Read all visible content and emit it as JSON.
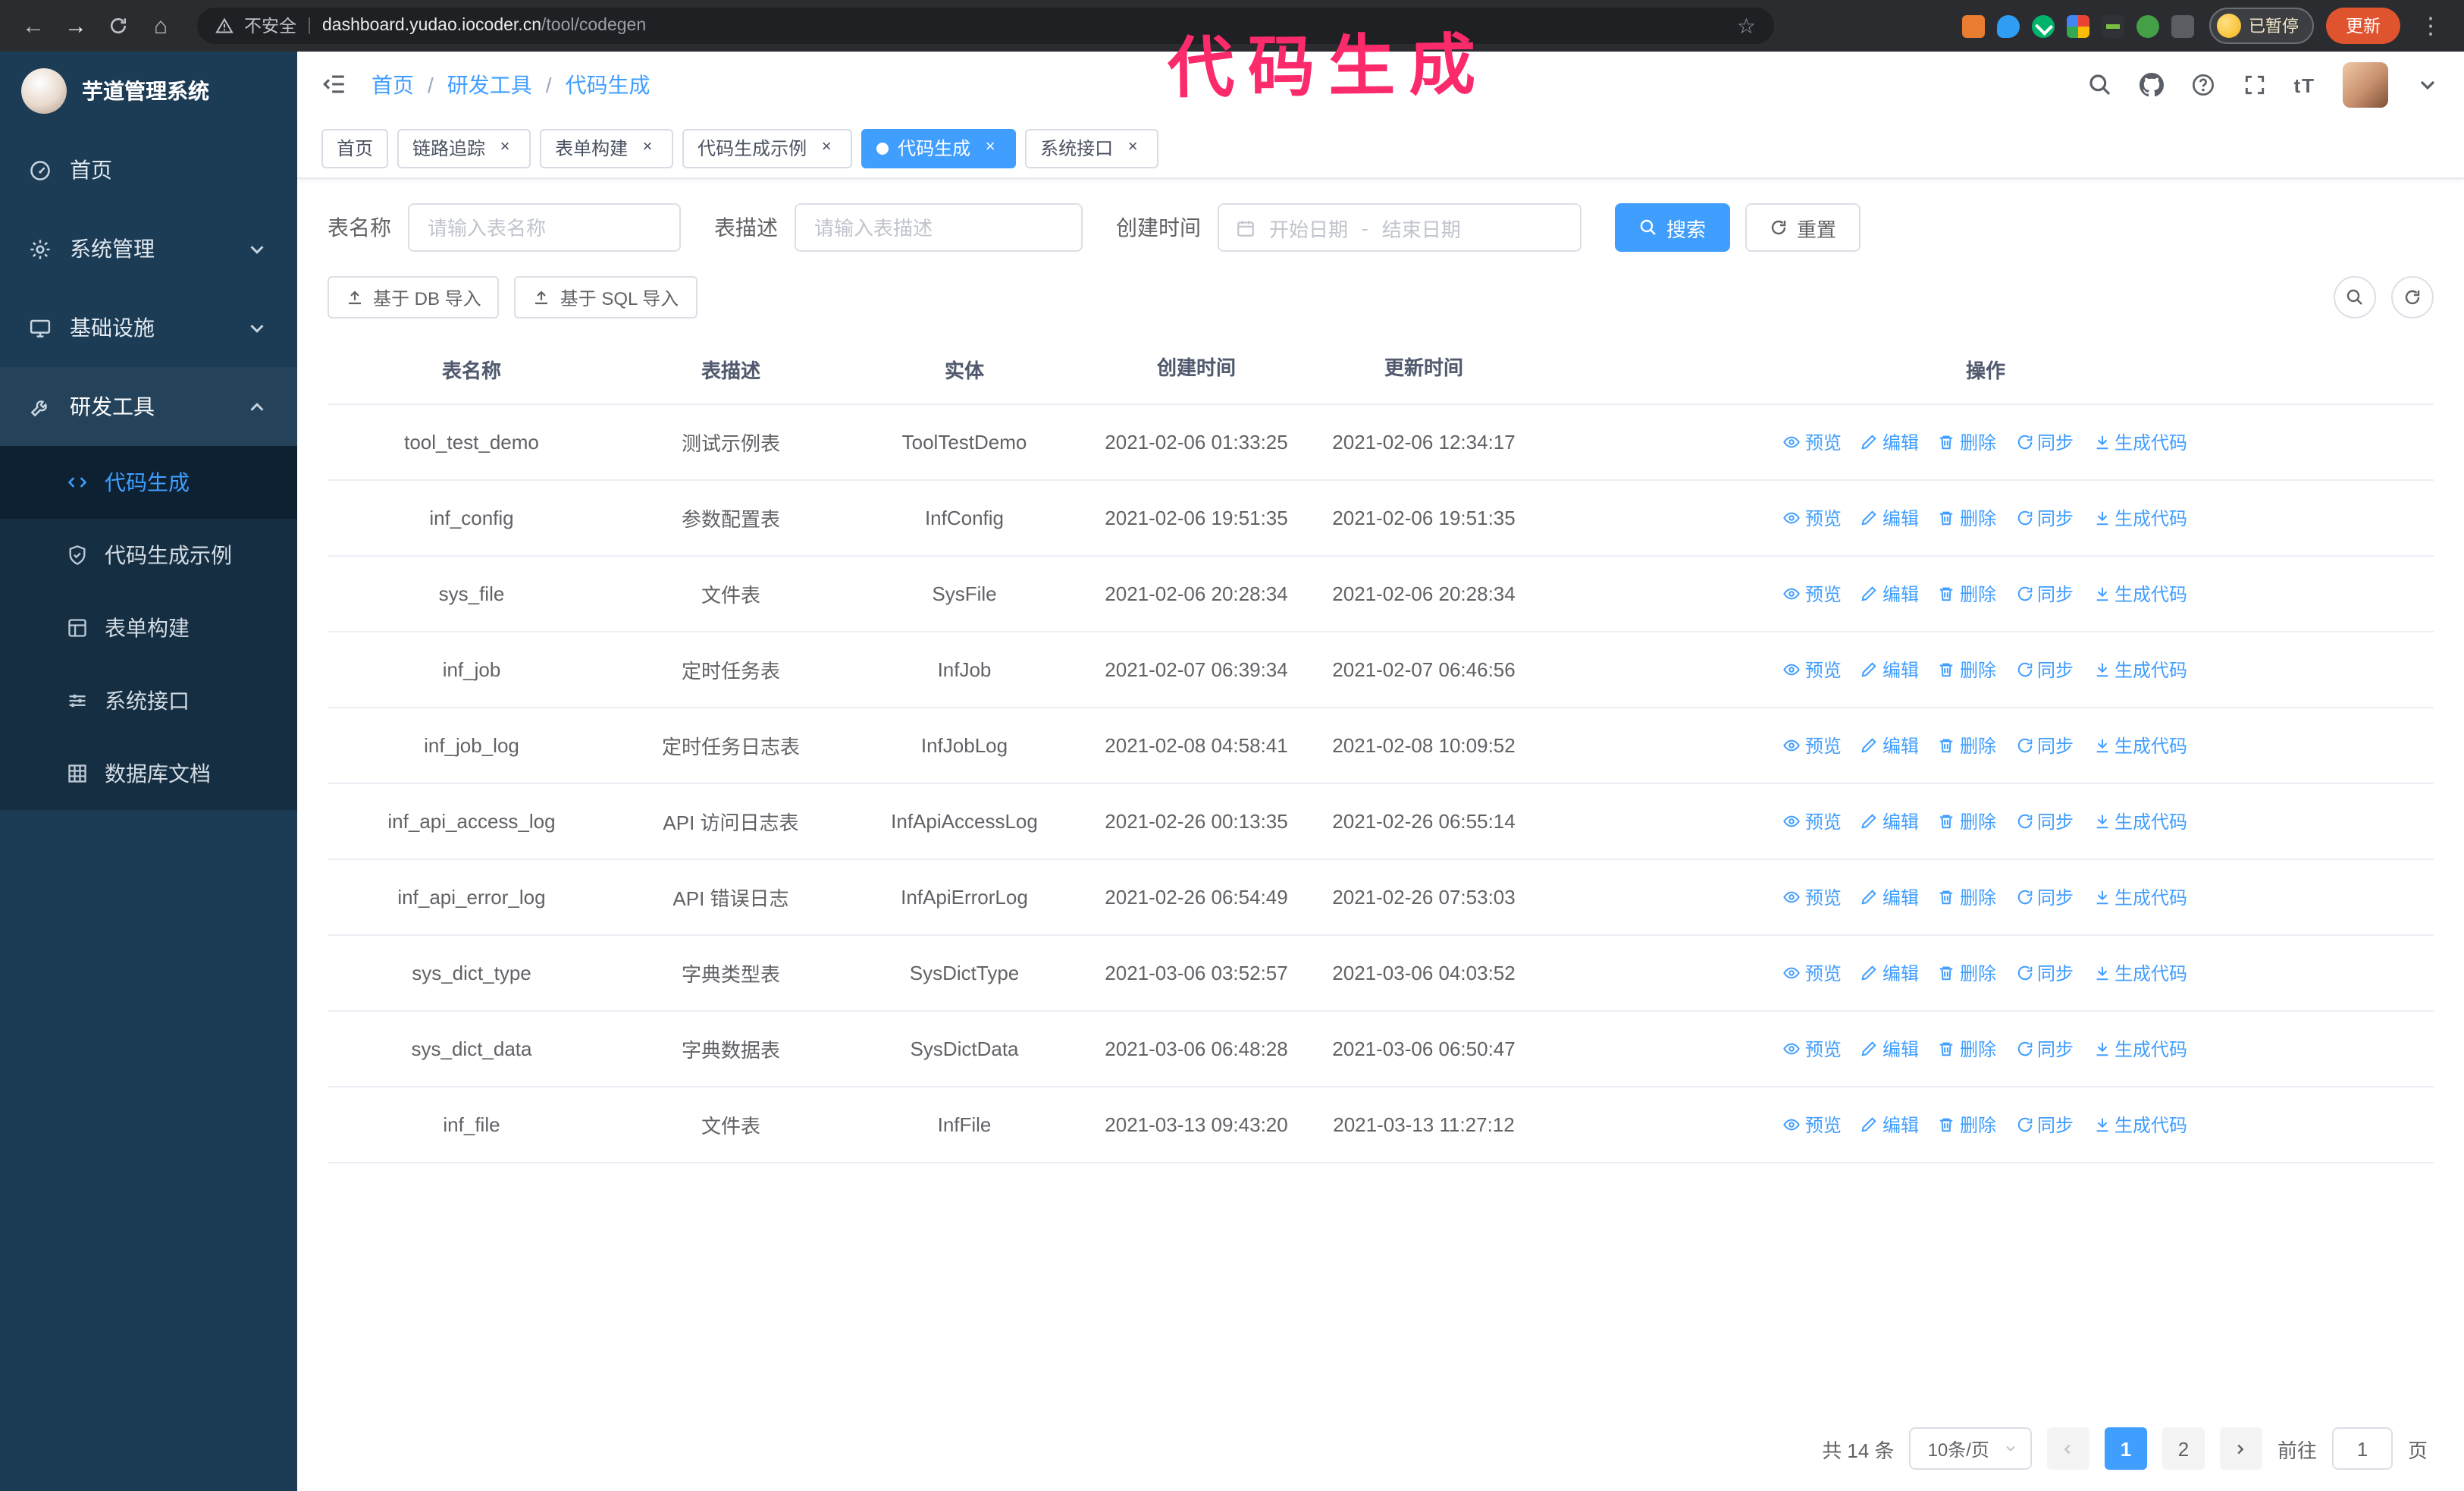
{
  "browser": {
    "security_warning": "不安全",
    "separator": "|",
    "url_host": "dashboard.yudao.iocoder.cn",
    "url_path": "/tool/codegen",
    "paused_badge": "已暂停",
    "update_button": "更新"
  },
  "annotation": {
    "text": "代码生成",
    "color": "#fb2a6b"
  },
  "sidebar": {
    "title": "芋道管理系统",
    "items": [
      {
        "label": "首页"
      },
      {
        "label": "系统管理"
      },
      {
        "label": "基础设施"
      },
      {
        "label": "研发工具"
      }
    ],
    "subitems": [
      {
        "label": "代码生成"
      },
      {
        "label": "代码生成示例"
      },
      {
        "label": "表单构建"
      },
      {
        "label": "系统接口"
      },
      {
        "label": "数据库文档"
      }
    ]
  },
  "breadcrumb": {
    "separator": "/",
    "items": [
      "首页",
      "研发工具",
      "代码生成"
    ]
  },
  "tabs": [
    {
      "label": "首页"
    },
    {
      "label": "链路追踪"
    },
    {
      "label": "表单构建"
    },
    {
      "label": "代码生成示例"
    },
    {
      "label": "代码生成"
    },
    {
      "label": "系统接口"
    }
  ],
  "filters": {
    "name_label": "表名称",
    "name_placeholder": "请输入表名称",
    "desc_label": "表描述",
    "desc_placeholder": "请输入表描述",
    "time_label": "创建时间",
    "start_placeholder": "开始日期",
    "range_separator": "-",
    "end_placeholder": "结束日期",
    "search_button": "搜索",
    "reset_button": "重置"
  },
  "toolbar": {
    "import_db_button": "基于 DB 导入",
    "import_sql_button": "基于 SQL 导入"
  },
  "table": {
    "columns": [
      "表名称",
      "表描述",
      "实体",
      "创建时间",
      "更新时间",
      "操作"
    ],
    "actions": [
      "预览",
      "编辑",
      "删除",
      "同步",
      "生成代码"
    ],
    "rows": [
      {
        "name": "tool_test_demo",
        "desc": "测试示例表",
        "entity": "ToolTestDemo",
        "created": "2021-02-06 01:33:25",
        "updated": "2021-02-06 12:34:17"
      },
      {
        "name": "inf_config",
        "desc": "参数配置表",
        "entity": "InfConfig",
        "created": "2021-02-06 19:51:35",
        "updated": "2021-02-06 19:51:35"
      },
      {
        "name": "sys_file",
        "desc": "文件表",
        "entity": "SysFile",
        "created": "2021-02-06 20:28:34",
        "updated": "2021-02-06 20:28:34"
      },
      {
        "name": "inf_job",
        "desc": "定时任务表",
        "entity": "InfJob",
        "created": "2021-02-07 06:39:34",
        "updated": "2021-02-07 06:46:56"
      },
      {
        "name": "inf_job_log",
        "desc": "定时任务日志表",
        "entity": "InfJobLog",
        "created": "2021-02-08 04:58:41",
        "updated": "2021-02-08 10:09:52"
      },
      {
        "name": "inf_api_access_log",
        "desc": "API 访问日志表",
        "entity": "InfApiAccessLog",
        "created": "2021-02-26 00:13:35",
        "updated": "2021-02-26 06:55:14"
      },
      {
        "name": "inf_api_error_log",
        "desc": "API 错误日志",
        "entity": "InfApiErrorLog",
        "created": "2021-02-26 06:54:49",
        "updated": "2021-02-26 07:53:03"
      },
      {
        "name": "sys_dict_type",
        "desc": "字典类型表",
        "entity": "SysDictType",
        "created": "2021-03-06 03:52:57",
        "updated": "2021-03-06 04:03:52"
      },
      {
        "name": "sys_dict_data",
        "desc": "字典数据表",
        "entity": "SysDictData",
        "created": "2021-03-06 06:48:28",
        "updated": "2021-03-06 06:50:47"
      },
      {
        "name": "inf_file",
        "desc": "文件表",
        "entity": "InfFile",
        "created": "2021-03-13 09:43:20",
        "updated": "2021-03-13 11:27:12"
      }
    ]
  },
  "pagination": {
    "total": "共 14 条",
    "page_size": "10条/页",
    "page1": "1",
    "page2": "2",
    "goto_label": "前往",
    "goto_value": "1",
    "unit_label": "页"
  },
  "colors": {
    "accent": "#409eff",
    "annotation": "#fb2a6b",
    "sidebar_bg": "#1c3c55"
  }
}
